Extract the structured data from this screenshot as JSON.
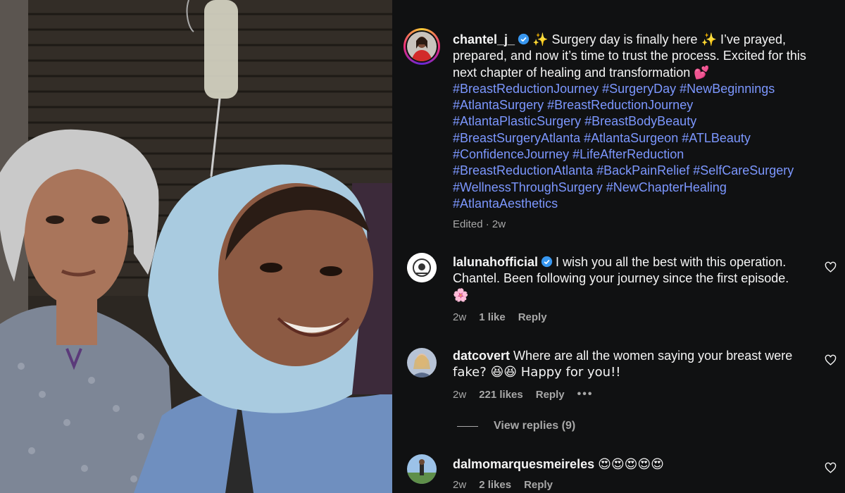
{
  "post": {
    "username": "chantel_j_",
    "caption_lines": [
      "✨ Surgery day is finally here ✨ I’ve prayed,",
      "prepared, and now it’s time to trust the process. Excited for this",
      "next chapter of healing and transformation 💕"
    ],
    "hashtag_lines": [
      "#BreastReductionJourney #SurgeryDay #NewBeginnings",
      "#AtlantaSurgery #BreastReductionJourney",
      "#AtlantaPlasticSurgery #BreastBodyBeauty",
      "#BreastSurgeryAtlanta #AtlantaSurgeon #ATLBeauty",
      "#ConfidenceJourney #LifeAfterReduction",
      "#BreastReductionAtlanta #BackPainRelief #SelfCareSurgery",
      "#WellnessThroughSurgery #NewChapterHealing",
      "#AtlantaAesthetics"
    ],
    "edited_meta": "Edited · 2w"
  },
  "comments": [
    {
      "username": "lalunahofficial",
      "verified": true,
      "lines": [
        "I wish you all the best with this operation.",
        "Chantel. Been following your journey since the first episode.",
        "🌸"
      ],
      "age": "2w",
      "likes": "1 like",
      "reply": "Reply"
    },
    {
      "username": "datcovert",
      "verified": false,
      "lines": [
        "Where are all the women saying your breast were",
        "fake? 😆😆 Happy for you!!"
      ],
      "age": "2w",
      "likes": "221 likes",
      "reply": "Reply",
      "more": "•••",
      "view_replies": "View replies (9)"
    },
    {
      "username": "dalmomarquesmeireles",
      "verified": false,
      "lines": [
        "😍😍😍😍😍"
      ],
      "age": "2w",
      "likes": "2 likes",
      "reply": "Reply"
    }
  ],
  "colors": {
    "pane_bg": "#101112",
    "hashtag": "#7c97ff",
    "muted": "#a8a8a8",
    "verified": "#3897f0"
  },
  "icons": {
    "verified": "verified-badge-icon",
    "like": "heart-outline-icon",
    "more": "more-options-icon"
  }
}
